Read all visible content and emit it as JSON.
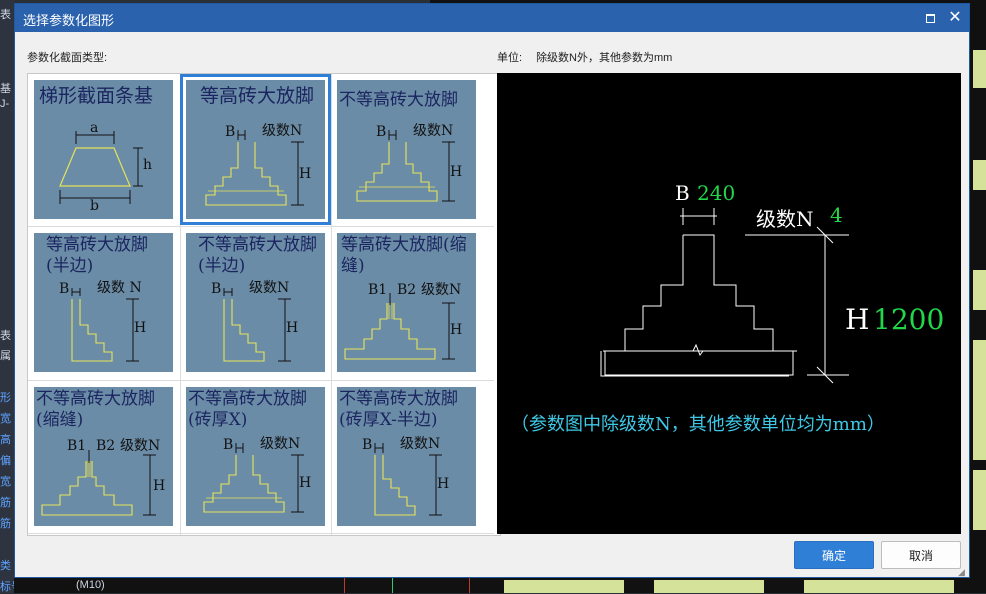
{
  "dialog": {
    "title": "选择参数化图形",
    "maximize_icon": "maximize-icon",
    "close_icon": "close-icon",
    "section_type_label": "参数化截面类型:",
    "unit_label": "单位:",
    "unit_note": "除级数N外，其他参数为mm",
    "ok_label": "确定",
    "cancel_label": "取消"
  },
  "thumbnails": [
    {
      "title": "梯形截面条基",
      "labels": [
        "a",
        "h",
        "b"
      ]
    },
    {
      "title": "等高砖大放脚",
      "labels": [
        "B",
        "级数N",
        "H"
      ]
    },
    {
      "title": "不等高砖大放脚",
      "labels": [
        "B",
        "级数N",
        "H"
      ]
    },
    {
      "title": "等高砖大放脚(半边)",
      "labels": [
        "B",
        "级数 N",
        "H"
      ]
    },
    {
      "title": "不等高砖大放脚(半边)",
      "labels": [
        "B",
        "级数N",
        "H"
      ]
    },
    {
      "title": "等高砖大放脚(缩缝)",
      "labels": [
        "B1",
        "B2",
        "级数N",
        "H"
      ]
    },
    {
      "title": "不等高砖大放脚(缩缝)",
      "labels": [
        "B1",
        "B2",
        "级数N",
        "H"
      ]
    },
    {
      "title": "不等高砖大放脚(砖厚X)",
      "labels": [
        "B",
        "级数N",
        "H"
      ]
    },
    {
      "title": "不等高砖大放脚(砖厚X-半边)",
      "labels": [
        "B",
        "级数N",
        "H"
      ]
    }
  ],
  "preview": {
    "b_label": "B",
    "b_value": "240",
    "n_label": "级数N",
    "n_value": "4",
    "h_label": "H",
    "h_value": "1200",
    "note": "（参数图中除级数N，其他参数单位均为mm）",
    "colors": {
      "values": "#22d84a",
      "note": "#3ec8e6",
      "lines": "#ffffff"
    }
  },
  "background": {
    "left_texts": [
      "表",
      "基",
      "J-",
      "表",
      "属",
      "形",
      "宽",
      "高",
      "偏",
      "宽",
      "筋",
      "筋",
      "类",
      "标号"
    ],
    "bottom_text": "(M10)"
  }
}
